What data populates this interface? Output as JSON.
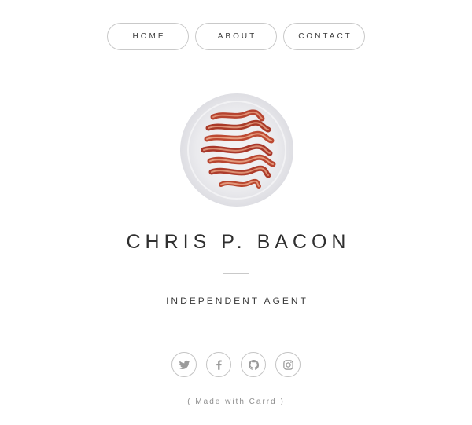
{
  "nav": {
    "items": [
      {
        "label": "HOME"
      },
      {
        "label": "ABOUT"
      },
      {
        "label": "CONTACT"
      }
    ]
  },
  "profile": {
    "avatar_icon": "bacon-plate-photo",
    "name": "CHRIS P. BACON",
    "tagline": "INDEPENDENT AGENT"
  },
  "social": {
    "icons": [
      "twitter-icon",
      "facebook-icon",
      "github-icon",
      "instagram-icon"
    ]
  },
  "footer": {
    "text": "( Made with Carrd )"
  },
  "colors": {
    "text": "#2e2e2e",
    "border": "#c9c9c9",
    "muted": "#8f8f8f",
    "icon": "#9a9a9a",
    "bacon": "#b8452f"
  }
}
